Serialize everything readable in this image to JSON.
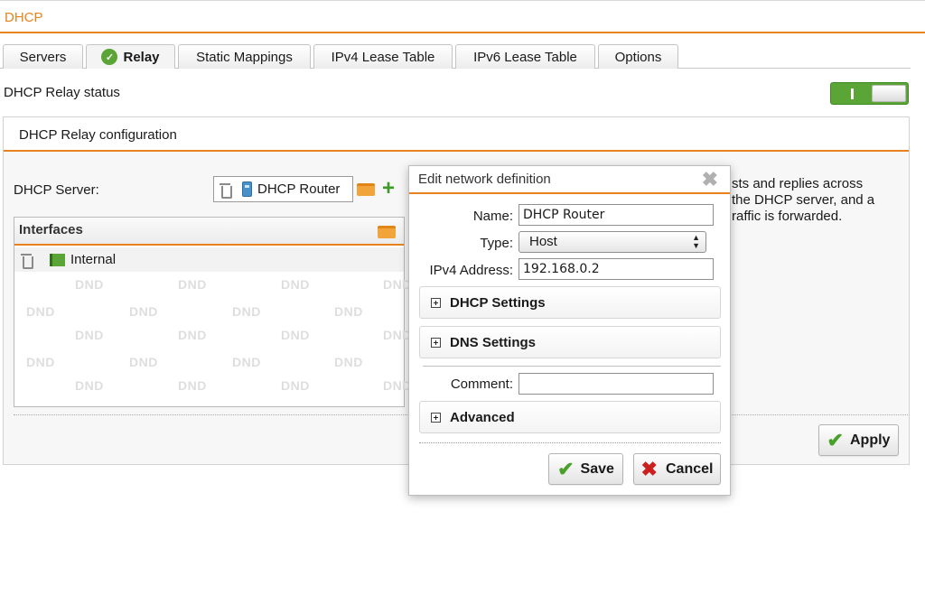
{
  "page": {
    "title": "DHCP"
  },
  "tabs": [
    {
      "label": "Servers",
      "active": false
    },
    {
      "label": "Relay",
      "active": true
    },
    {
      "label": "Static Mappings",
      "active": false
    },
    {
      "label": "IPv4 Lease Table",
      "active": false
    },
    {
      "label": "IPv6 Lease Table",
      "active": false
    },
    {
      "label": "Options",
      "active": false
    }
  ],
  "relay_status": {
    "label": "DHCP Relay status",
    "enabled": true,
    "toggle_glyph": "I"
  },
  "config": {
    "title": "DHCP Relay configuration",
    "server_label": "DHCP Server:",
    "server_value": "DHCP Router",
    "interfaces_title": "Interfaces",
    "interfaces": [
      {
        "name": "Internal"
      }
    ],
    "dnd_watermark": "DND",
    "description_lines": [
      "sts and replies across",
      "the DHCP server, and a",
      "raffic is forwarded."
    ],
    "apply_label": "Apply"
  },
  "dialog": {
    "title": "Edit network definition",
    "close_glyph": "✖",
    "name_label": "Name:",
    "name_value": "DHCP Router",
    "type_label": "Type:",
    "type_value": "Host",
    "ipv4_label": "IPv4 Address:",
    "ipv4_value": "192.168.0.2",
    "dhcp_settings_label": "DHCP Settings",
    "dns_settings_label": "DNS Settings",
    "comment_label": "Comment:",
    "comment_value": "",
    "advanced_label": "Advanced",
    "save_label": "Save",
    "cancel_label": "Cancel"
  },
  "colors": {
    "accent": "#e8821e",
    "success": "#5aa535",
    "danger": "#cc1f1f"
  },
  "icons": [
    "check-circle-icon",
    "trash-icon",
    "host-icon",
    "folder-icon",
    "plus-icon",
    "flag-icon",
    "close-icon",
    "expand-icon",
    "checkmark-icon",
    "x-icon"
  ]
}
